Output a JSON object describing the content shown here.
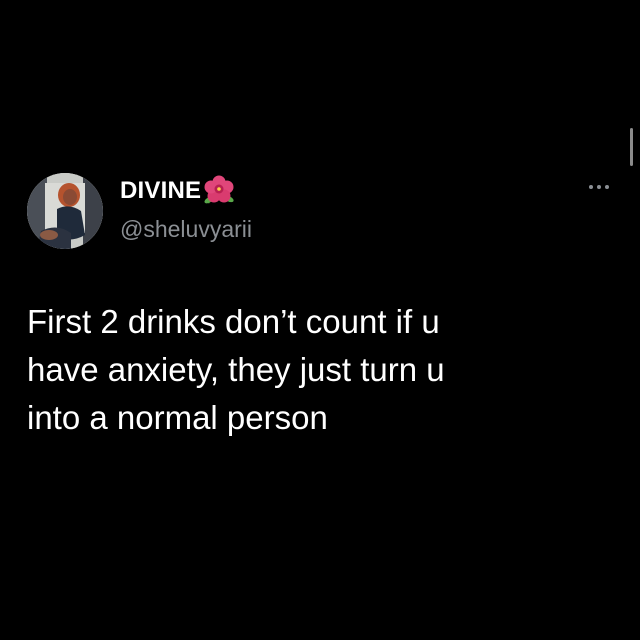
{
  "tweet": {
    "display_name": "DIVINE",
    "handle": "@sheluvyarii",
    "body": "First 2 drinks don’t count if u\nhave anxiety, they just turn u\ninto a normal person",
    "avatar_icon": "profile-photo-avatar",
    "name_emoji_icon": "hibiscus-flower-icon",
    "menu_icon": "more-options-icon"
  },
  "colors": {
    "background": "#000000",
    "primary_text": "#ffffff",
    "secondary_text": "#8b8f94",
    "hibiscus": "#e0467a"
  }
}
